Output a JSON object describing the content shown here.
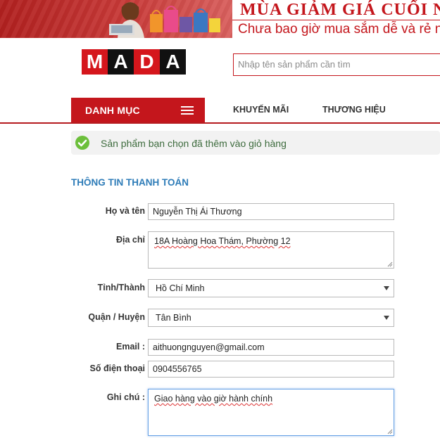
{
  "banner": {
    "title": "MÙA GIẢM GIÁ CUỐI N",
    "subtitle": "Chưa bao giờ mua sắm dễ và rẻ n"
  },
  "logo": {
    "letters": [
      "M",
      "A",
      "D",
      "A"
    ]
  },
  "search": {
    "placeholder": "Nhập tên sản phẩm cần tìm",
    "value": ""
  },
  "nav": {
    "category_label": "DANH MỤC",
    "links": [
      "KHUYẾN MÃI",
      "THƯƠNG HIỆU"
    ]
  },
  "alert": {
    "message": "Sản phẩm bạn chọn đã thêm vào giỏ hàng"
  },
  "checkout": {
    "section_title": "THÔNG TIN THANH TOÁN",
    "full_name": {
      "label": "Họ và tên",
      "value": "Nguyễn Thị Ái Thương"
    },
    "address": {
      "label": "Địa chỉ",
      "value": "18A Hoàng Hoa Thám, Phường 12"
    },
    "province": {
      "label": "Tỉnh/Thành",
      "value": "Hồ Chí Minh"
    },
    "district": {
      "label": "Quận / Huyện",
      "value": "Tân Bình"
    },
    "email": {
      "label": "Email :",
      "value": "aithuongnguyen@gmail.com"
    },
    "phone": {
      "label": "Số điện thoại",
      "value": "0904556765"
    },
    "note": {
      "label": "Ghi chú :",
      "value": "Giao hàng vào giờ hành chính"
    }
  },
  "colors": {
    "brand_red": "#c4161c",
    "title_blue": "#2e7cb8",
    "success_green": "#6cbf3b"
  }
}
